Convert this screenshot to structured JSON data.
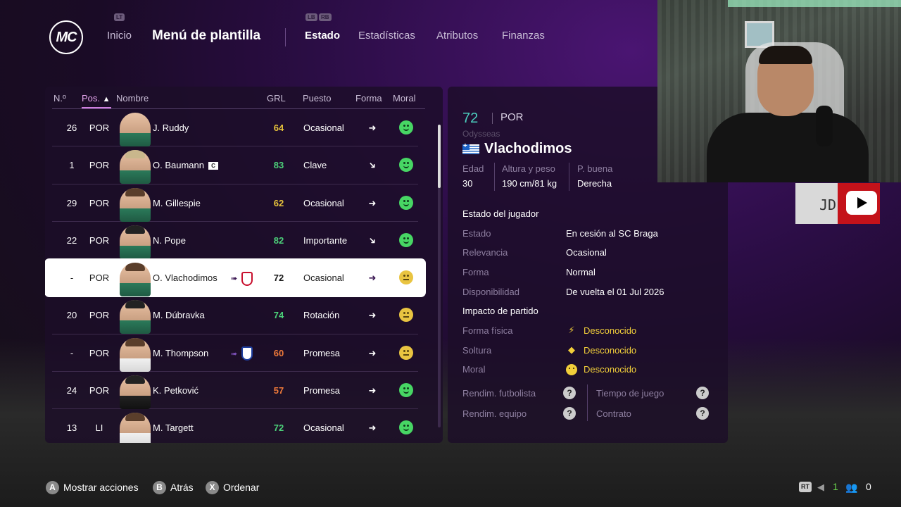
{
  "header": {
    "logo_text": "MC",
    "nav_home": "Inicio",
    "title": "Menú de plantilla",
    "hint_lt": "LT",
    "hint_lb": "LB",
    "hint_rb": "RB",
    "tabs": [
      "Estado",
      "Estadísticas",
      "Atributos",
      "Finanzas"
    ],
    "active_tab": "Estado"
  },
  "table": {
    "headers": {
      "num": "N.º",
      "pos": "Pos.",
      "sort_icon": "▲",
      "name": "Nombre",
      "grl": "GRL",
      "role": "Puesto",
      "form": "Forma",
      "moral": "Moral"
    },
    "rows": [
      {
        "num": "26",
        "pos": "POR",
        "name": "J. Ruddy",
        "grl": "64",
        "role": "Ocasional",
        "form_icon": "➜"
      },
      {
        "num": "1",
        "pos": "POR",
        "name": "O. Baumann",
        "captain": "C",
        "grl": "83",
        "role": "Clave",
        "form_icon": "➜"
      },
      {
        "num": "29",
        "pos": "POR",
        "name": "M. Gillespie",
        "grl": "62",
        "role": "Ocasional",
        "form_icon": "➜"
      },
      {
        "num": "22",
        "pos": "POR",
        "name": "N. Pope",
        "grl": "82",
        "role": "Importante",
        "form_icon": "➜"
      },
      {
        "num": "-",
        "pos": "POR",
        "name": "O. Vlachodimos",
        "grl": "72",
        "role": "Ocasional",
        "form_icon": "➜",
        "loan_icon": "➠"
      },
      {
        "num": "20",
        "pos": "POR",
        "name": "M. Dúbravka",
        "grl": "74",
        "role": "Rotación",
        "form_icon": "➜"
      },
      {
        "num": "-",
        "pos": "POR",
        "name": "M. Thompson",
        "grl": "60",
        "role": "Promesa",
        "form_icon": "➜",
        "loan_icon": "➠"
      },
      {
        "num": "24",
        "pos": "POR",
        "name": "K. Petković",
        "grl": "57",
        "role": "Promesa",
        "form_icon": "➜"
      },
      {
        "num": "13",
        "pos": "LI",
        "name": "M. Targett",
        "grl": "72",
        "role": "Ocasional",
        "form_icon": "➜"
      }
    ]
  },
  "detail": {
    "rating": "72",
    "position": "POR",
    "first_name": "Odysseas",
    "last_name": "Vlachodimos",
    "age_label": "Edad",
    "age": "30",
    "hw_label": "Altura y peso",
    "hw": "190 cm/81 kg",
    "foot_label": "P. buena",
    "foot": "Derecha",
    "status_title": "Estado del jugador",
    "estado_label": "Estado",
    "estado": "En cesión al SC Braga",
    "relevancia_label": "Relevancia",
    "relevancia": "Ocasional",
    "forma_label": "Forma",
    "forma": "Normal",
    "disp_label": "Disponibilidad",
    "disp": "De vuelta el 01 Jul 2026",
    "impact_title": "Impacto de partido",
    "fisica_label": "Forma física",
    "fisica": "Desconocido",
    "soltura_label": "Soltura",
    "soltura": "Desconocido",
    "moral_label": "Moral",
    "moral": "Desconocido",
    "rend_fut": "Rendim. futbolista",
    "rend_eq": "Rendim. equipo",
    "tiempo": "Tiempo de juego",
    "contrato": "Contrato",
    "qmark": "?"
  },
  "overlay": {
    "yt_text": "JD"
  },
  "footer": {
    "a_key": "A",
    "a_label": "Mostrar acciones",
    "b_key": "B",
    "b_label": "Atrás",
    "x_key": "X",
    "x_label": "Ordenar",
    "rt": "RT",
    "volume": "1",
    "people": "0"
  }
}
